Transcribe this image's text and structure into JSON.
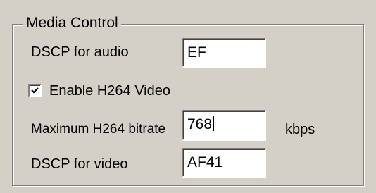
{
  "group": {
    "title": "Media Control"
  },
  "dscp_audio": {
    "label": "DSCP for audio",
    "value": "EF"
  },
  "h264": {
    "label": "Enable H264 Video",
    "checked": true
  },
  "bitrate": {
    "label": "Maximum H264 bitrate",
    "value": "768",
    "unit": "kbps"
  },
  "dscp_video": {
    "label": "DSCP for video",
    "value": "AF41"
  }
}
